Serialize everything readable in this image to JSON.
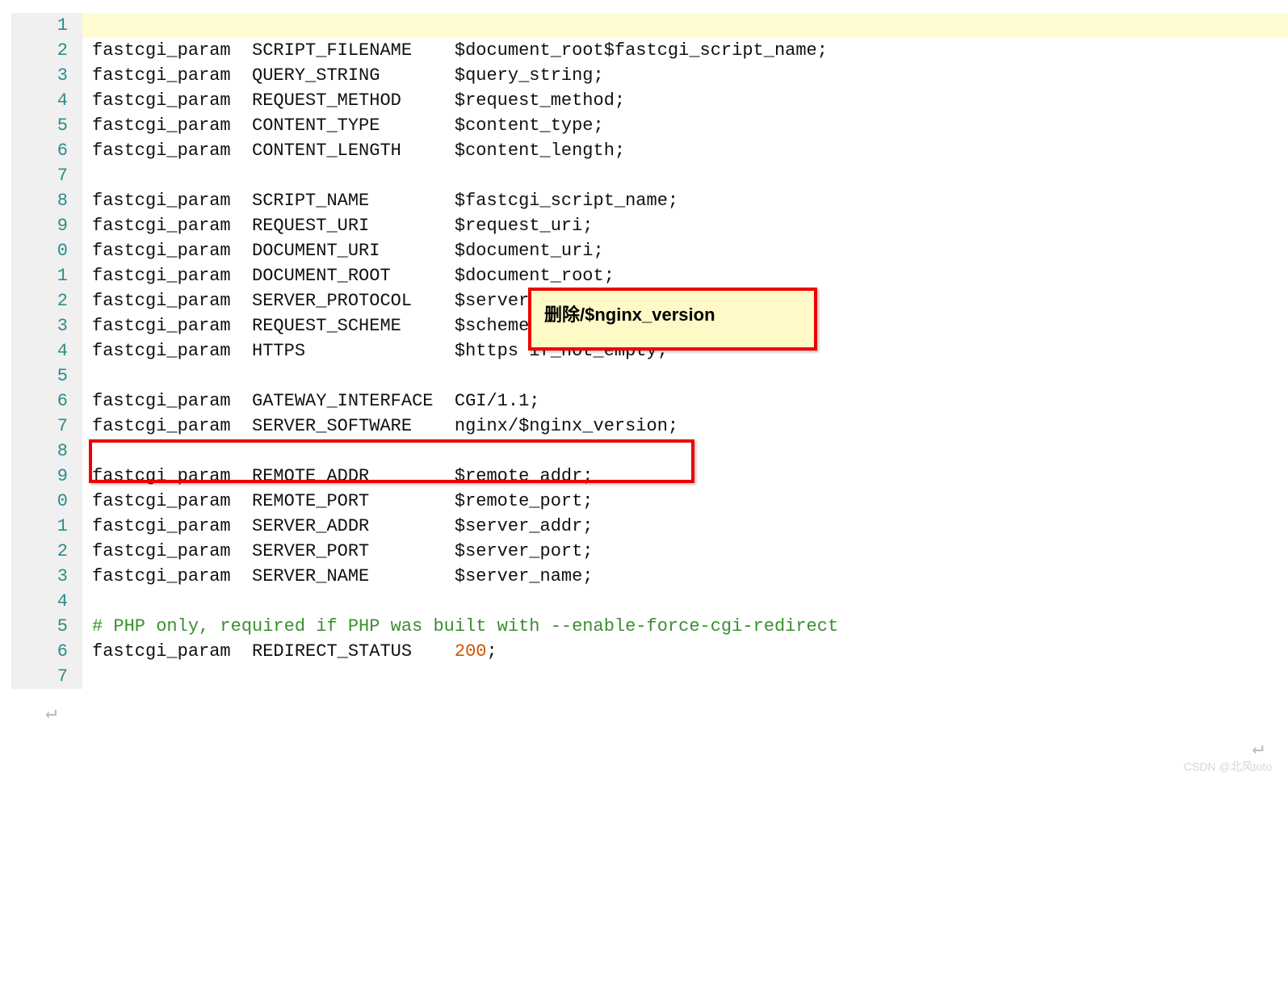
{
  "annotation": {
    "note_text": "删除/$nginx_version"
  },
  "watermark": "CSDN @北风toto",
  "lines": [
    {
      "n": "1",
      "cls": "current",
      "segs": []
    },
    {
      "n": "2",
      "segs": [
        {
          "t": "fastcgi_param  SCRIPT_FILENAME    $document_root$fastcgi_script_name;"
        }
      ]
    },
    {
      "n": "3",
      "segs": [
        {
          "t": "fastcgi_param  QUERY_STRING       $query_string;"
        }
      ]
    },
    {
      "n": "4",
      "segs": [
        {
          "t": "fastcgi_param  REQUEST_METHOD     $request_method;"
        }
      ]
    },
    {
      "n": "5",
      "segs": [
        {
          "t": "fastcgi_param  CONTENT_TYPE       $content_type;"
        }
      ]
    },
    {
      "n": "6",
      "segs": [
        {
          "t": "fastcgi_param  CONTENT_LENGTH     $content_length;"
        }
      ]
    },
    {
      "n": "7",
      "segs": []
    },
    {
      "n": "8",
      "segs": [
        {
          "t": "fastcgi_param  SCRIPT_NAME        $fastcgi_script_name;"
        }
      ]
    },
    {
      "n": "9",
      "segs": [
        {
          "t": "fastcgi_param  REQUEST_URI        $request_uri;"
        }
      ]
    },
    {
      "n": "0",
      "segs": [
        {
          "t": "fastcgi_param  DOCUMENT_URI       $document_uri;"
        }
      ]
    },
    {
      "n": "1",
      "segs": [
        {
          "t": "fastcgi_param  DOCUMENT_ROOT      $document_root;"
        }
      ]
    },
    {
      "n": "2",
      "segs": [
        {
          "t": "fastcgi_param  SERVER_PROTOCOL    $server_protocol;"
        }
      ]
    },
    {
      "n": "3",
      "segs": [
        {
          "t": "fastcgi_param  REQUEST_SCHEME     $scheme;"
        }
      ]
    },
    {
      "n": "4",
      "segs": [
        {
          "t": "fastcgi_param  HTTPS              $https if_not_empty;"
        }
      ]
    },
    {
      "n": "5",
      "segs": []
    },
    {
      "n": "6",
      "segs": [
        {
          "t": "fastcgi_param  GATEWAY_INTERFACE  CGI/1.1;"
        }
      ]
    },
    {
      "n": "7",
      "segs": [
        {
          "t": "fastcgi_param  SERVER_SOFTWARE    nginx/$nginx_version;"
        }
      ]
    },
    {
      "n": "8",
      "segs": []
    },
    {
      "n": "9",
      "segs": [
        {
          "t": "fastcgi_param  REMOTE_ADDR        $remote_addr;"
        }
      ]
    },
    {
      "n": "0",
      "segs": [
        {
          "t": "fastcgi_param  REMOTE_PORT        $remote_port;"
        }
      ]
    },
    {
      "n": "1",
      "segs": [
        {
          "t": "fastcgi_param  SERVER_ADDR        $server_addr;"
        }
      ]
    },
    {
      "n": "2",
      "segs": [
        {
          "t": "fastcgi_param  SERVER_PORT        $server_port;"
        }
      ]
    },
    {
      "n": "3",
      "segs": [
        {
          "t": "fastcgi_param  SERVER_NAME        $server_name;"
        }
      ]
    },
    {
      "n": "4",
      "segs": []
    },
    {
      "n": "5",
      "segs": [
        {
          "t": "# PHP only, required if PHP was built with --enable-force-cgi-redirect",
          "c": "tok-comment"
        }
      ]
    },
    {
      "n": "6",
      "segs": [
        {
          "t": "fastcgi_param  REDIRECT_STATUS    "
        },
        {
          "t": "200",
          "c": "tok-number"
        },
        {
          "t": ";"
        }
      ]
    },
    {
      "n": "7",
      "segs": []
    }
  ]
}
